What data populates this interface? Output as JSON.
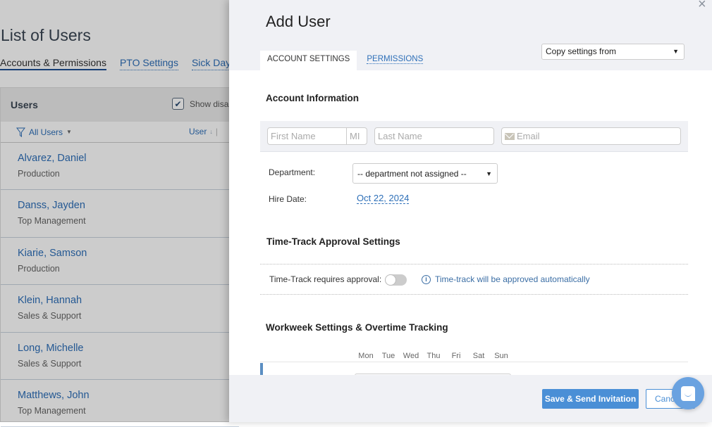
{
  "background_page": {
    "title": "List of Users",
    "tabs": [
      {
        "label": "Accounts & Permissions",
        "active": true
      },
      {
        "label": "PTO Settings",
        "active": false
      },
      {
        "label": "Sick Days",
        "active": false
      }
    ],
    "users_panel": {
      "title": "Users",
      "show_disabled_label": "Show disab",
      "show_disabled_checked": true,
      "filter_label": "All Users",
      "sort_label": "User",
      "users": [
        {
          "name": "Alvarez, Daniel",
          "department": "Production"
        },
        {
          "name": "Danss, Jayden",
          "department": "Top Management"
        },
        {
          "name": "Kiarie, Samson",
          "department": "Production"
        },
        {
          "name": "Klein, Hannah",
          "department": "Sales & Support"
        },
        {
          "name": "Long, Michelle",
          "department": "Sales & Support"
        },
        {
          "name": "Matthews, John",
          "department": "Top Management"
        }
      ]
    }
  },
  "drawer": {
    "title": "Add User",
    "close_icon": "×",
    "tabs": [
      {
        "label": "ACCOUNT SETTINGS",
        "active": true
      },
      {
        "label": "PERMISSIONS",
        "active": false
      }
    ],
    "copy_settings": {
      "selected": "Copy settings from"
    },
    "account_info": {
      "title": "Account Information",
      "first_name_placeholder": "First Name",
      "mi_placeholder": "MI",
      "last_name_placeholder": "Last Name",
      "email_placeholder": "Email",
      "department_label": "Department:",
      "department_value": "-- department not assigned --",
      "hire_date_label": "Hire Date:",
      "hire_date_value": "Oct 22, 2024"
    },
    "approval": {
      "title": "Time-Track Approval Settings",
      "toggle_label": "Time-Track requires approval:",
      "toggle_on": false,
      "info_icon": "i",
      "info_text": "Time-track will be approved automatically"
    },
    "workweek": {
      "title": "Workweek Settings & Overtime Tracking",
      "days": [
        "Mon",
        "Tue",
        "Wed",
        "Thu",
        "Fri",
        "Sat",
        "Sun"
      ]
    },
    "footer": {
      "save_label": "Save & Send Invitation",
      "cancel_label": "Cancel"
    }
  },
  "colors": {
    "accent": "#4a8fd6",
    "link": "#2d6fb8",
    "chat_bubble": "#6aa2e0"
  }
}
